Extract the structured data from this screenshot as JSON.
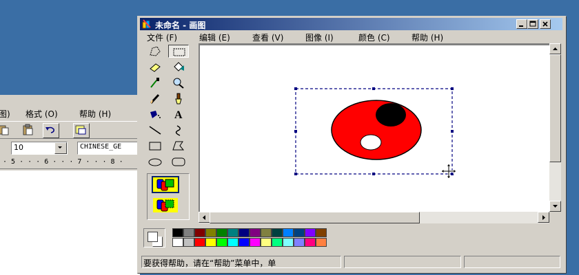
{
  "wordpad": {
    "menu": [
      "图)",
      "格式 (O)",
      "帮助 (H)"
    ],
    "font_size": "10",
    "font_name": "CHINESE_GE",
    "ruler": "· 5 · · · 6 · · · 7 · · · 8 ·"
  },
  "paint": {
    "title": "未命名 - 画图",
    "menu": [
      {
        "label": "文件 (F)"
      },
      {
        "label": "编辑 (E)"
      },
      {
        "label": "查看 (V)"
      },
      {
        "label": "图像 (I)"
      },
      {
        "label": "颜色 (C)"
      },
      {
        "label": "帮助 (H)"
      }
    ],
    "tools": [
      {
        "name": "free-form-select-tool-button",
        "icon": "free-form-select-icon"
      },
      {
        "name": "rect-select-tool-button",
        "icon": "rect-select-icon",
        "pressed": true
      },
      {
        "name": "eraser-tool-button",
        "icon": "eraser-icon"
      },
      {
        "name": "fill-tool-button",
        "icon": "fill-bucket-icon"
      },
      {
        "name": "pick-color-tool-button",
        "icon": "eyedropper-icon"
      },
      {
        "name": "magnifier-tool-button",
        "icon": "magnifier-icon"
      },
      {
        "name": "pencil-tool-button",
        "icon": "pencil-icon"
      },
      {
        "name": "brush-tool-button",
        "icon": "brush-icon"
      },
      {
        "name": "airbrush-tool-button",
        "icon": "airbrush-icon"
      },
      {
        "name": "text-tool-button",
        "icon": "text-icon",
        "glyph": "A"
      },
      {
        "name": "line-tool-button",
        "icon": "line-icon"
      },
      {
        "name": "curve-tool-button",
        "icon": "curve-icon"
      },
      {
        "name": "rectangle-tool-button",
        "icon": "rectangle-icon"
      },
      {
        "name": "polygon-tool-button",
        "icon": "polygon-icon"
      },
      {
        "name": "ellipse-tool-button",
        "icon": "ellipse-icon"
      },
      {
        "name": "rounded-rect-tool-button",
        "icon": "rounded-rect-icon"
      }
    ],
    "palette_top": [
      "#000000",
      "#808080",
      "#800000",
      "#808000",
      "#008000",
      "#008080",
      "#000080",
      "#800080",
      "#808040",
      "#004040",
      "#0080ff",
      "#004080",
      "#8000ff",
      "#804000"
    ],
    "palette_bottom": [
      "#ffffff",
      "#c0c0c0",
      "#ff0000",
      "#ffff00",
      "#00ff00",
      "#00ffff",
      "#0000ff",
      "#ff00ff",
      "#ffff80",
      "#00ff80",
      "#80ffff",
      "#8080ff",
      "#ff0080",
      "#ff8040"
    ],
    "status": "要获得帮助，请在“帮助”菜单中，单",
    "colors": {
      "desktop": "#3a6ea5",
      "title_active_start": "#0a246a",
      "title_active_end": "#a6caf0",
      "face": "#d4d0c8",
      "drawing_fill": "#ff0000",
      "drawing_dark_spot": "#000000",
      "drawing_light_spot": "#ffffff",
      "selection_outline": "#000080"
    }
  }
}
